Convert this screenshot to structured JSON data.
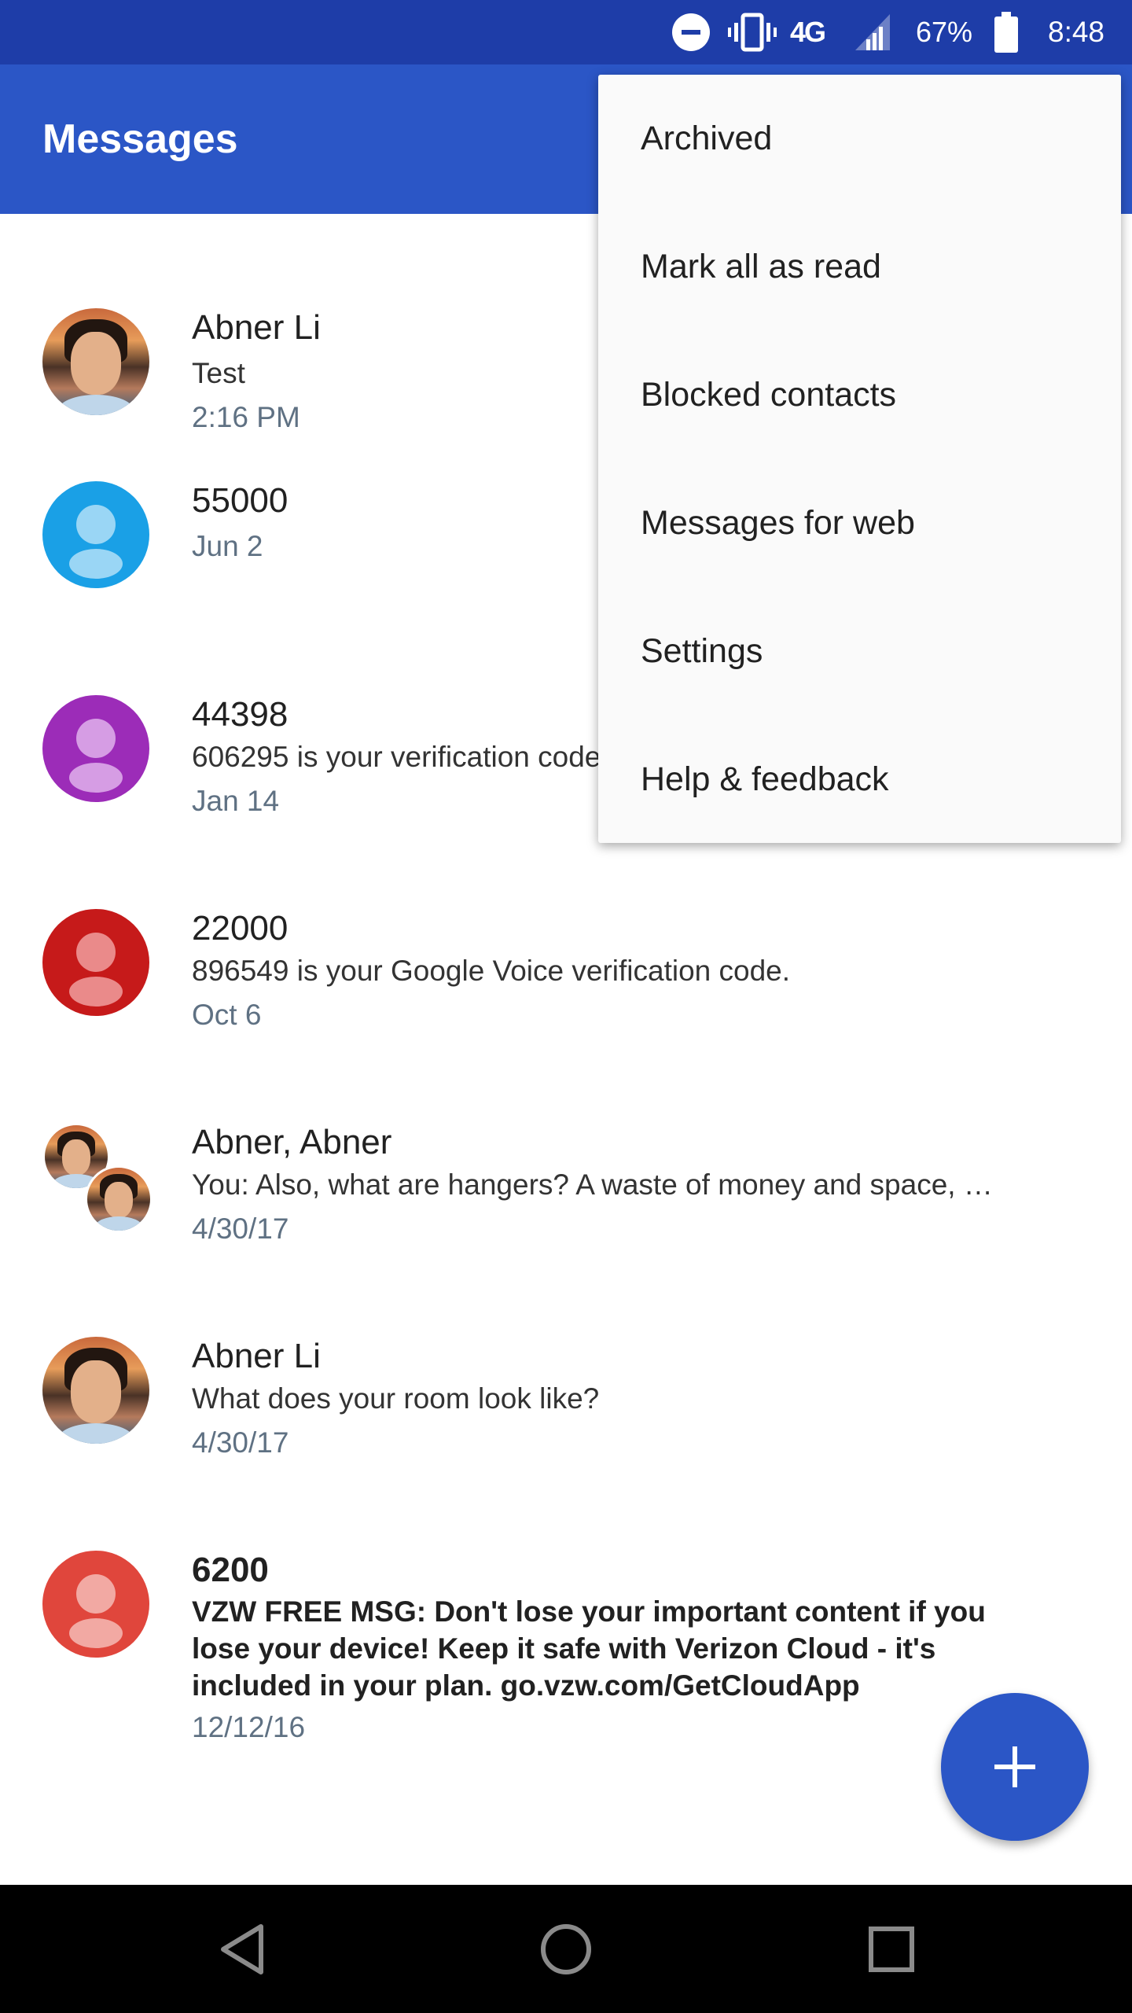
{
  "status_bar": {
    "network": "4G",
    "battery": "67%",
    "time": "8:48",
    "icons": [
      "do-not-disturb-icon",
      "vibrate-icon",
      "lte-icon",
      "signal-icon",
      "battery-icon"
    ]
  },
  "app_bar": {
    "title": "Messages",
    "color": "#2b56c6"
  },
  "conversations": [
    {
      "name": "Abner Li",
      "snippet": "Test",
      "time": "2:16 PM",
      "avatar": "photo"
    },
    {
      "name": "55000",
      "snippet": "",
      "time": "Jun 2",
      "avatar": "person",
      "color": "#1aa0e6"
    },
    {
      "name": "44398",
      "snippet": "606295 is your verification code",
      "time": "Jan 14",
      "avatar": "person",
      "color": "#9c2cb8"
    },
    {
      "name": "22000",
      "snippet": "896549 is your Google Voice verification code.",
      "time": "Oct 6",
      "avatar": "person",
      "color": "#c61a1a"
    },
    {
      "name": "Abner, Abner",
      "snippet": "You: Also, what are hangers? A waste of money and space, …",
      "time": "4/30/17",
      "avatar": "group"
    },
    {
      "name": "Abner Li",
      "snippet": "What does your room look like?",
      "time": "4/30/17",
      "avatar": "photo"
    },
    {
      "name": "6200",
      "snippet": "VZW FREE MSG: Don't lose your important content if you lose your device! Keep it safe with Verizon Cloud - it's included in your plan. go.vzw.com/GetCloudApp",
      "time": "12/12/16",
      "avatar": "person",
      "color": "#e0463c",
      "unread": true
    }
  ],
  "menu": {
    "items": [
      "Archived",
      "Mark all as read",
      "Blocked contacts",
      "Messages for web",
      "Settings",
      "Help & feedback"
    ]
  },
  "fab": {
    "icon": "plus-icon"
  },
  "nav_bar": {
    "icons": [
      "back-icon",
      "home-icon",
      "recents-icon"
    ]
  }
}
